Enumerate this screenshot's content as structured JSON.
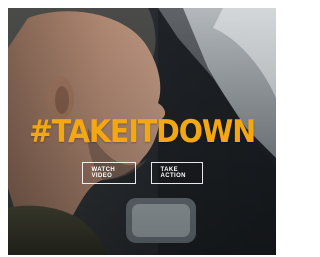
{
  "hero": {
    "headline": "#TAKEITDOWN",
    "headline_color": "#f3a712",
    "background_image": "man-in-vehicle-photo"
  },
  "buttons": {
    "watch_video": "WATCH VIDEO",
    "take_action": "TAKE ACTION"
  }
}
